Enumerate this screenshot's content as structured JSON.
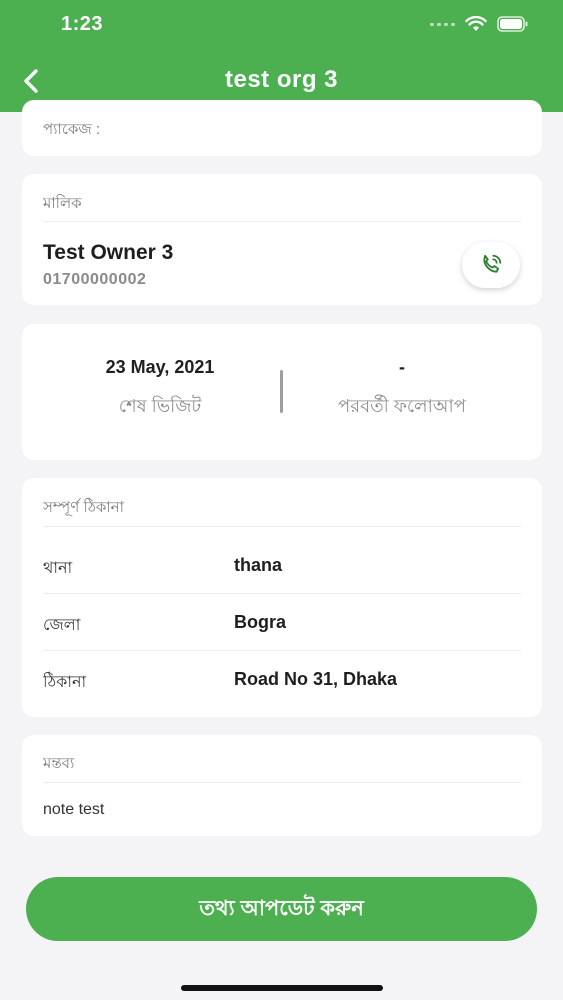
{
  "status_bar": {
    "time": "1:23"
  },
  "header": {
    "title": "test org 3"
  },
  "package": {
    "label": "প্যাকেজ :"
  },
  "owner": {
    "section_label": "মালিক",
    "name": "Test Owner 3",
    "phone": "01700000002"
  },
  "visit": {
    "last_visit_value": "23 May, 2021",
    "last_visit_label": "শেষ ভিজিট",
    "next_followup_value": "-",
    "next_followup_label": "পরবর্তী ফলোআপ"
  },
  "address": {
    "section_label": "সম্পূর্ণ ঠিকানা",
    "rows": [
      {
        "key": "থানা",
        "value": "thana"
      },
      {
        "key": "জেলা",
        "value": "Bogra"
      },
      {
        "key": "ঠিকানা",
        "value": "Road No 31, Dhaka"
      }
    ]
  },
  "note": {
    "section_label": "মন্তব্য",
    "text": "note test"
  },
  "update_button": {
    "label": "তথ্য আপডেট করুন"
  },
  "colors": {
    "brand": "#4caf50",
    "background": "#f4f4f6"
  },
  "icons": [
    "chevron-left-icon",
    "phone-icon",
    "wifi-icon",
    "battery-icon"
  ]
}
